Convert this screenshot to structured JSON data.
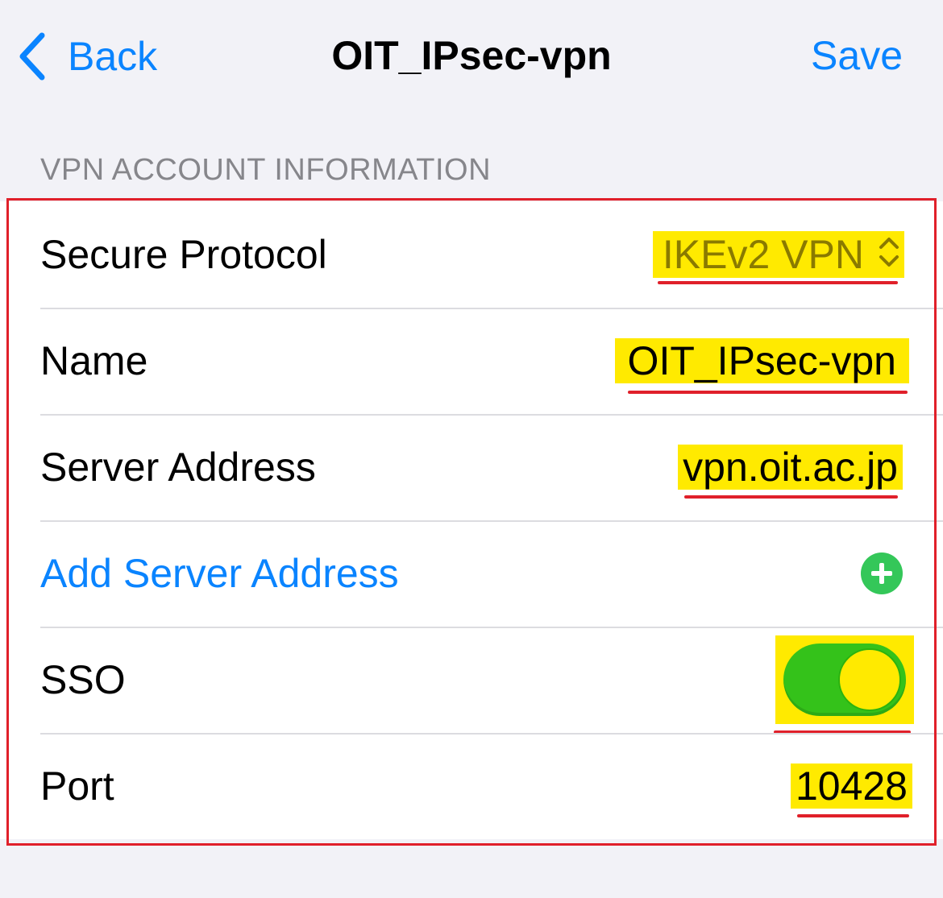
{
  "nav": {
    "back_label": "Back",
    "title": "OIT_IPsec-vpn",
    "save_label": "Save"
  },
  "section": {
    "header": "VPN ACCOUNT INFORMATION"
  },
  "rows": {
    "protocol": {
      "label": "Secure Protocol",
      "value": "IKEv2 VPN"
    },
    "name": {
      "label": "Name",
      "value": "OIT_IPsec-vpn"
    },
    "server": {
      "label": "Server Address",
      "value": "vpn.oit.ac.jp"
    },
    "add_server": {
      "label": "Add Server Address",
      "icon": "plus-circle-icon"
    },
    "sso": {
      "label": "SSO",
      "enabled": true
    },
    "port": {
      "label": "Port",
      "value": "10428"
    }
  },
  "colors": {
    "accent": "#0a84ff",
    "highlight": "#ffea00",
    "annotation_red": "#e0202a",
    "toggle_green": "#34c21a",
    "add_green": "#34c759"
  }
}
